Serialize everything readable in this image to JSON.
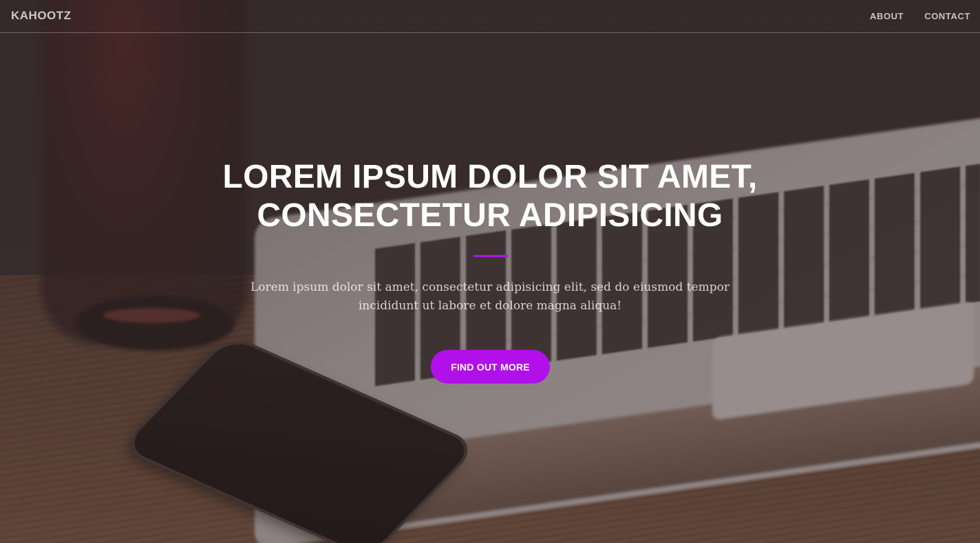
{
  "navbar": {
    "brand": "KAHOOTZ",
    "links": [
      {
        "label": "ABOUT"
      },
      {
        "label": "CONTACT"
      }
    ]
  },
  "hero": {
    "title_line1": "LOREM IPSUM DOLOR SIT AMET,",
    "title_line2": "CONSECTETUR ADIPISICING",
    "subtitle_line1": "Lorem ipsum dolor sit amet, consectetur adipisicing elit, sed do eiusmod tempor",
    "subtitle_line2": "incididunt ut labore et dolore magna aliqua!",
    "cta_label": "FIND OUT MORE"
  },
  "colors": {
    "accent": "#b110ea",
    "divider": "#b016e8",
    "overlay": "#3f3535"
  }
}
